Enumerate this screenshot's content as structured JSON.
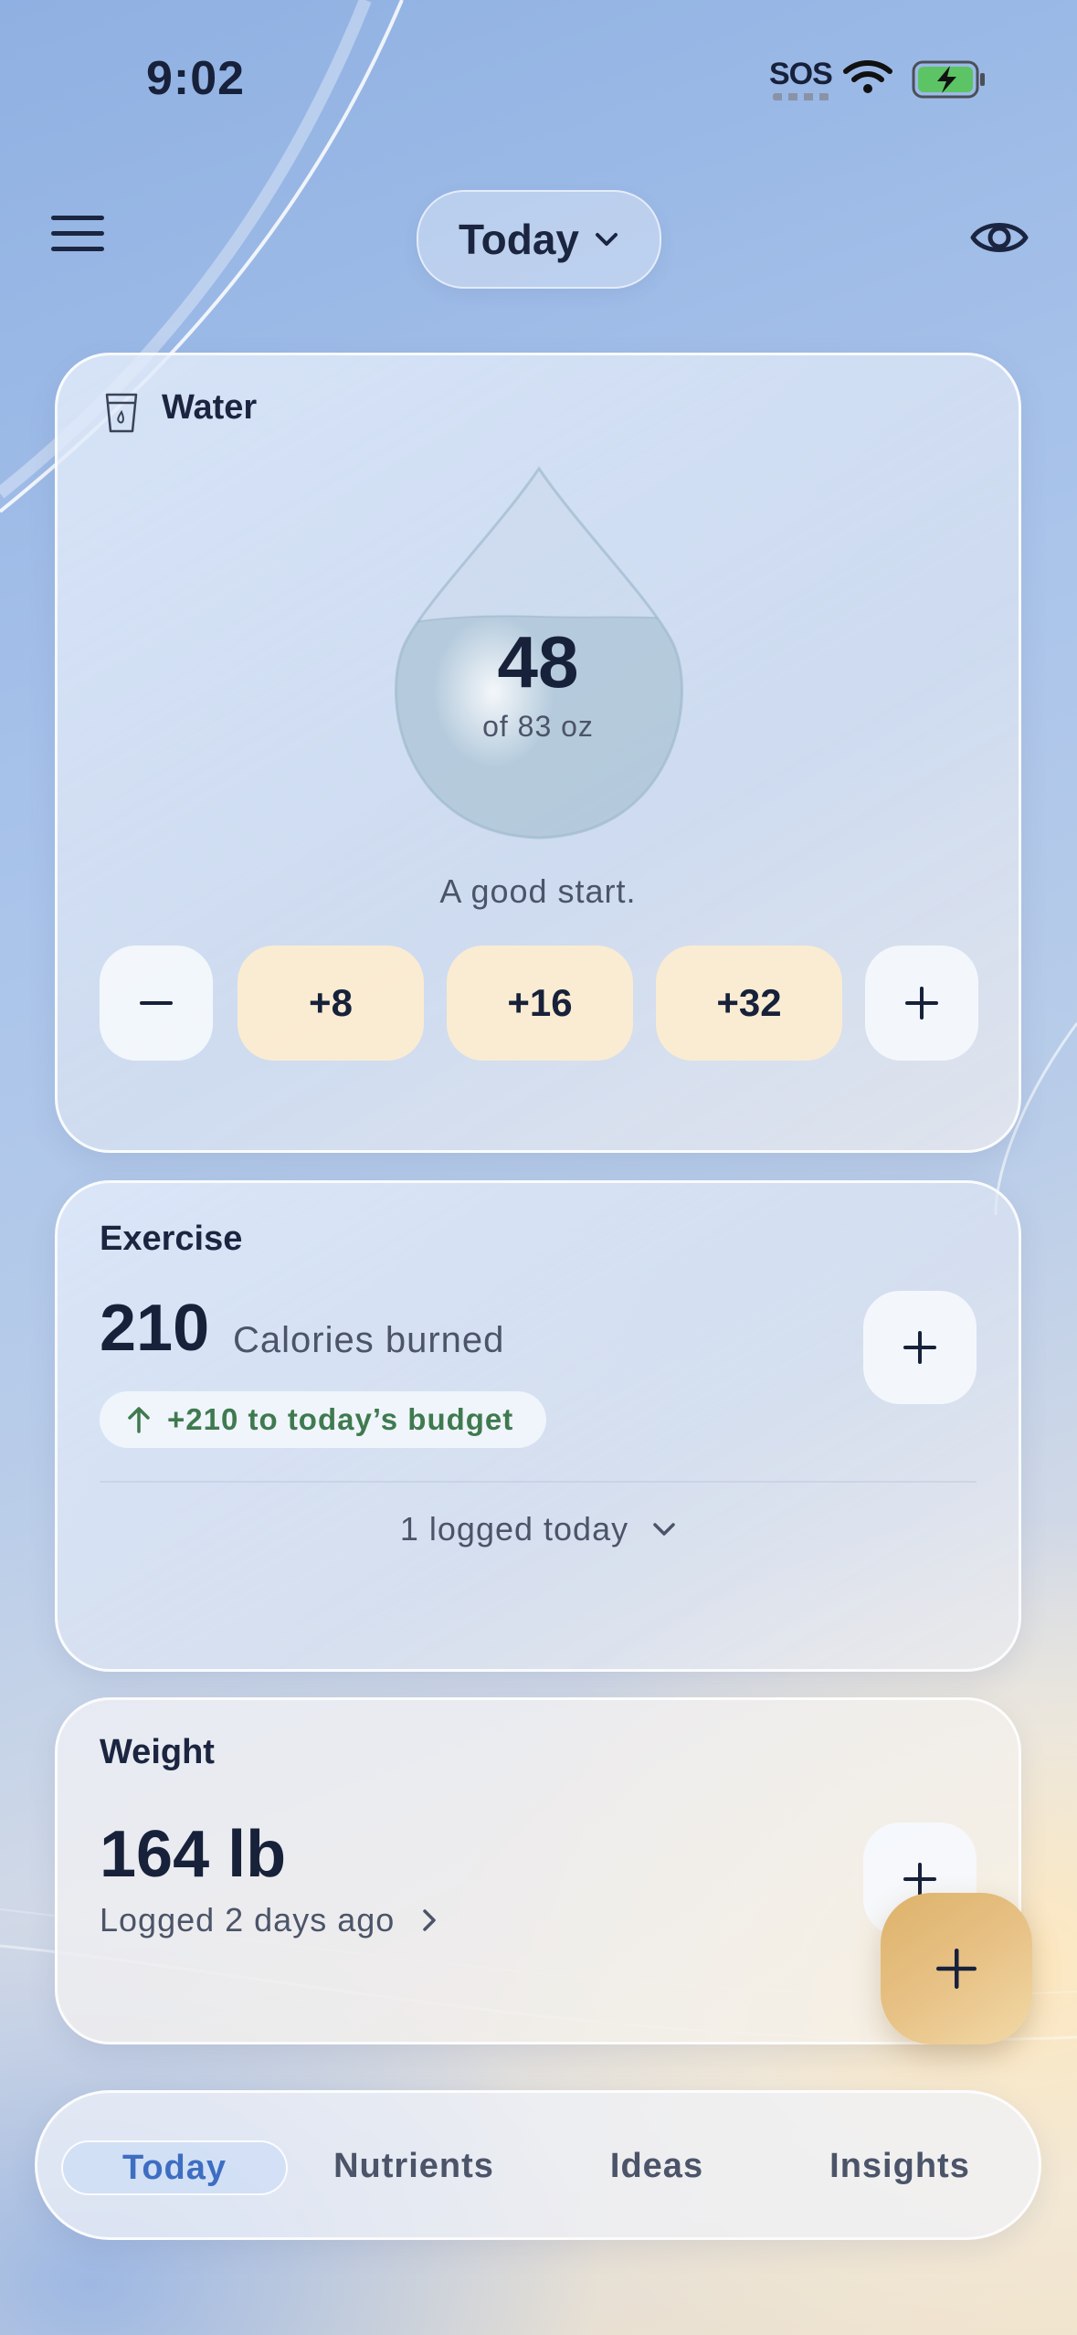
{
  "status_bar": {
    "time": "9:02",
    "sos": "SOS"
  },
  "header": {
    "date_selector": "Today"
  },
  "water": {
    "title": "Water",
    "amount": "48",
    "goal_text": "of 83 oz",
    "fill_fraction": 0.58,
    "message": "A good start.",
    "buttons": {
      "decrement": "−",
      "add_8": "+8",
      "add_16": "+16",
      "add_32": "+32",
      "increment": "+"
    }
  },
  "exercise": {
    "title": "Exercise",
    "calories": "210",
    "calories_label": "Calories burned",
    "budget_text": "+210 to today’s budget",
    "logged_text": "1 logged today"
  },
  "weight": {
    "title": "Weight",
    "value": "164 lb",
    "last_logged": "Logged 2 days ago"
  },
  "tabs": [
    {
      "label": "Today",
      "active": true
    },
    {
      "label": "Nutrients",
      "active": false
    },
    {
      "label": "Ideas",
      "active": false
    },
    {
      "label": "Insights",
      "active": false
    }
  ],
  "colors": {
    "accent_blue": "#3d6ec2",
    "budget_green": "#3f7a4f",
    "fab_amber": "#e2b76f",
    "quick_add_amber": "#fcecd0"
  },
  "icons": [
    "menu-icon",
    "chevron-down-icon",
    "eye-icon",
    "cup-icon",
    "plus-icon",
    "minus-icon",
    "arrow-up-icon",
    "chevron-right-icon",
    "wifi-icon",
    "battery-charging-icon"
  ]
}
